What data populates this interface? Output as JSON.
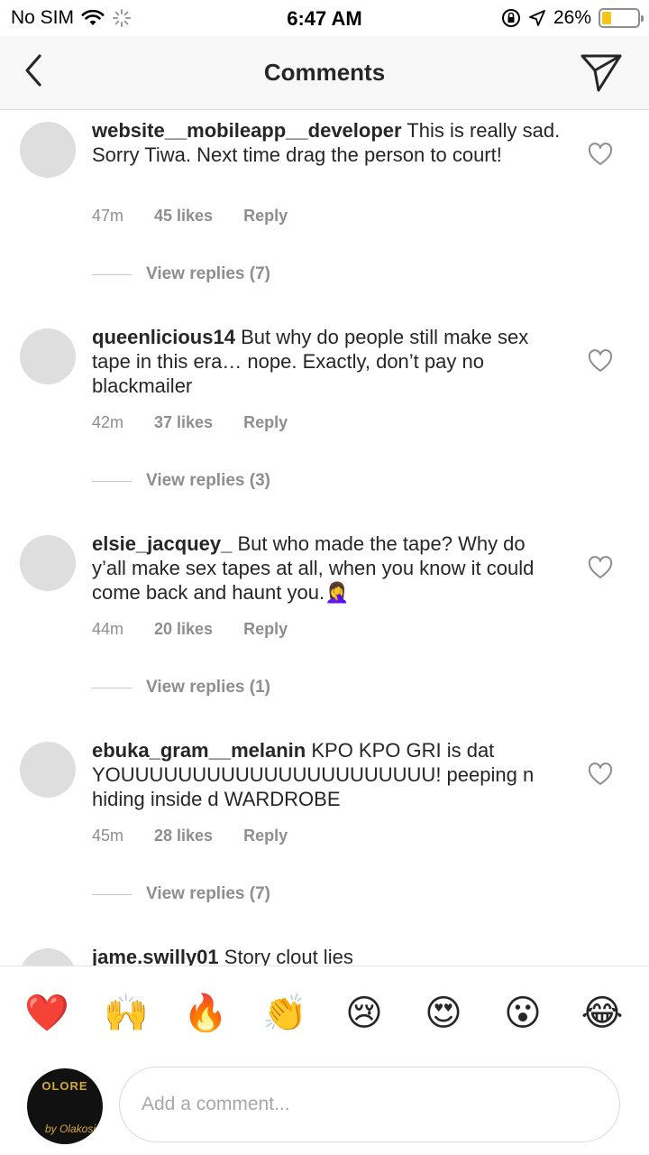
{
  "status_bar": {
    "carrier": "No SIM",
    "time": "6:47 AM",
    "battery_percent_label": "26%",
    "battery_level": 0.26
  },
  "header": {
    "title": "Comments"
  },
  "comments": [
    {
      "username": "website__mobileapp__developer",
      "text": " This is really sad. Sorry Tiwa. Next time drag the person to court!",
      "time": "47m",
      "likes": "45 likes",
      "reply_label": "Reply",
      "view_replies": "View replies (7)"
    },
    {
      "username": "queenlicious14",
      "text": " But why do people still make sex tape in this era… nope. Exactly, don’t pay no blackmailer",
      "time": "42m",
      "likes": "37 likes",
      "reply_label": "Reply",
      "view_replies": "View replies (3)"
    },
    {
      "username": "elsie_jacquey_",
      "text": " But who made the tape? Why do y’all make sex tapes at all, when you know it could come back and haunt you.🤦‍♀️",
      "time": "44m",
      "likes": "20 likes",
      "reply_label": "Reply",
      "view_replies": "View replies (1)"
    },
    {
      "username": "ebuka_gram__melanin",
      "text": " KPO KPO GRI is dat YOUUUUUUUUUUUUUUUUUUUUUU! peeping n hiding inside d WARDROBE",
      "time": "45m",
      "likes": "28 likes",
      "reply_label": "Reply",
      "view_replies": "View replies (7)"
    },
    {
      "username": "jame.swilly01",
      "text": " Story clout lies"
    }
  ],
  "emoji_bar": [
    {
      "name": "red-heart-emoji",
      "glyph": "❤️"
    },
    {
      "name": "raising-hands-emoji",
      "glyph": "🙌"
    },
    {
      "name": "fire-emoji",
      "glyph": "🔥"
    },
    {
      "name": "clapping-hands-emoji",
      "glyph": "👏"
    },
    {
      "name": "crying-face-emoji",
      "glyph": "😢"
    },
    {
      "name": "heart-eyes-emoji",
      "glyph": "😍"
    },
    {
      "name": "surprised-face-emoji",
      "glyph": "😮"
    },
    {
      "name": "tears-of-joy-emoji",
      "glyph": "😂"
    }
  ],
  "composer": {
    "placeholder": "Add a comment...",
    "avatar_brand": "OLORE",
    "avatar_signature": "by Olakosi"
  },
  "colors": {
    "text": "#262626",
    "muted": "#8e8e8e",
    "avatar_placeholder": "#dedede",
    "battery": "#f5c518"
  },
  "icons": [
    "back-chevron-icon",
    "send-paper-plane-icon",
    "heart-outline-icon",
    "wifi-icon",
    "loading-spinner-icon",
    "orientation-lock-icon",
    "location-arrow-icon",
    "battery-icon"
  ]
}
